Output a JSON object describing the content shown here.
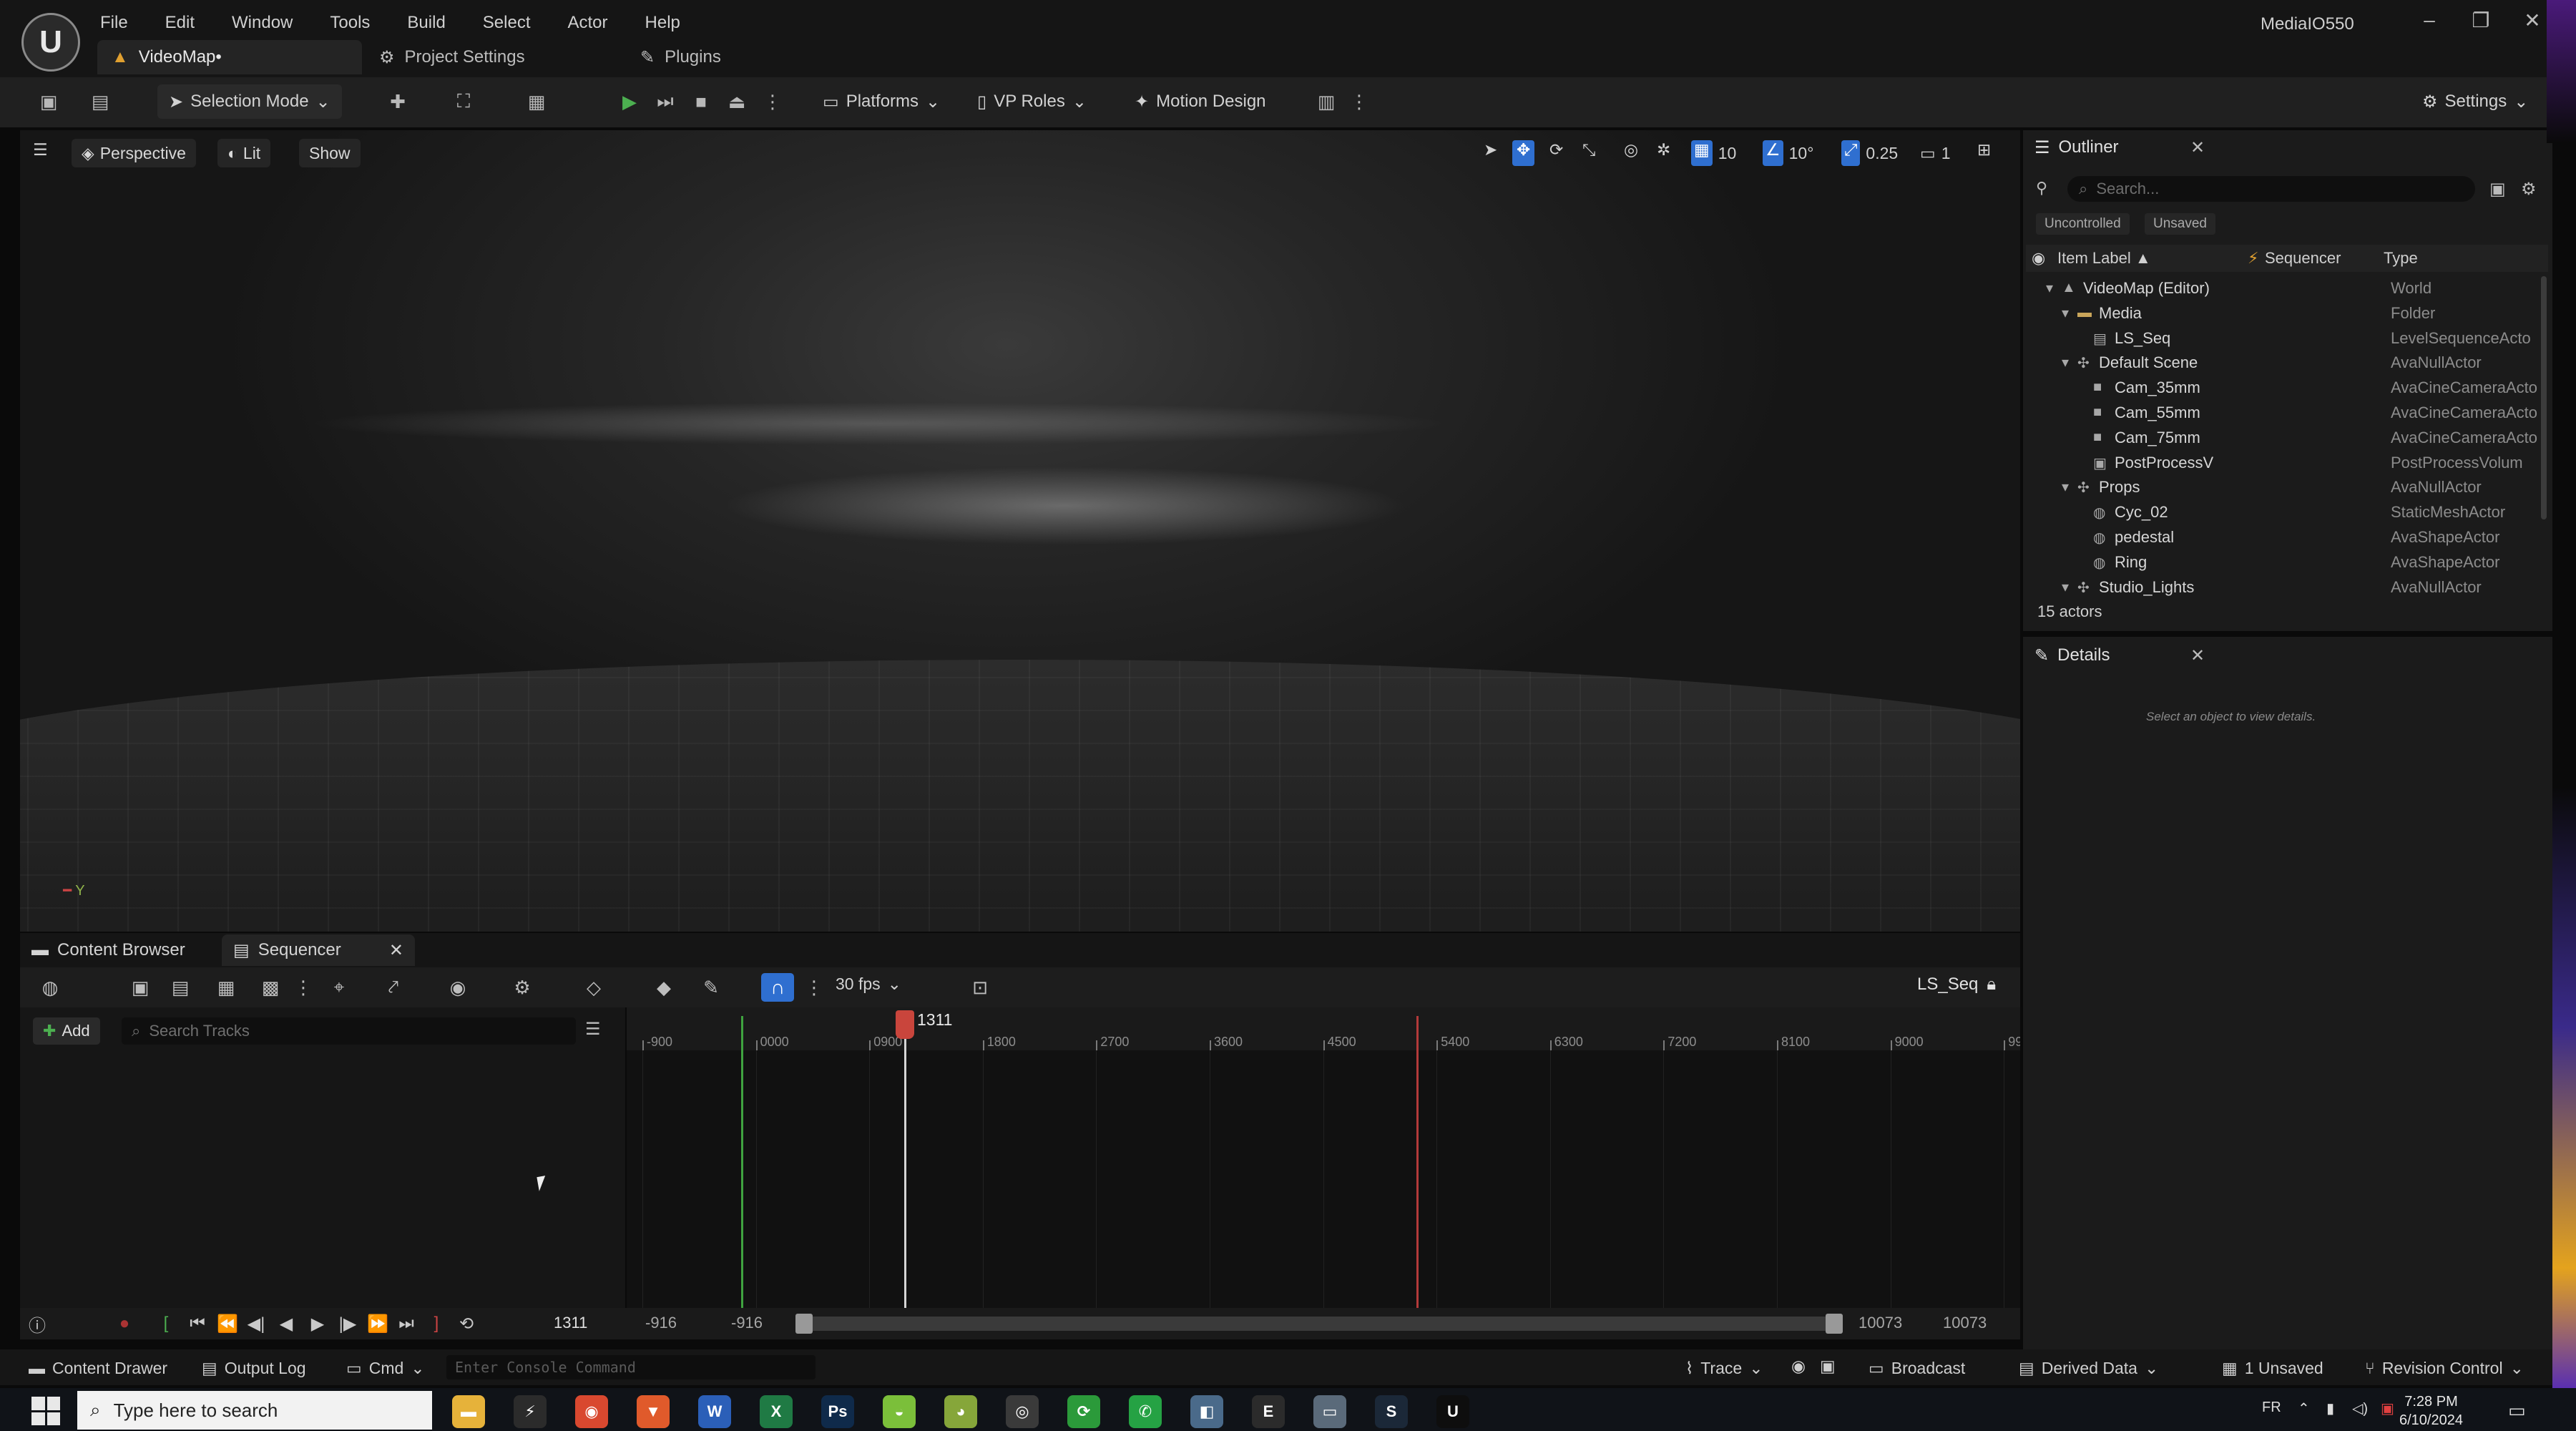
{
  "app": {
    "logo": "U",
    "menu": [
      "File",
      "Edit",
      "Window",
      "Tools",
      "Build",
      "Select",
      "Actor",
      "Help"
    ],
    "tabs": [
      {
        "label": "VideoMap•"
      },
      {
        "label": "Project Settings"
      },
      {
        "label": "Plugins"
      }
    ],
    "user": "MediaIO550",
    "window_controls": {
      "minimize": "–",
      "restore": "❐",
      "close": "✕"
    }
  },
  "toolbar": {
    "selection_mode": "Selection Mode",
    "platforms": "Platforms",
    "vp_roles": "VP Roles",
    "motion_design": "Motion Design",
    "settings": "Settings"
  },
  "viewport": {
    "perspective": "Perspective",
    "lit": "Lit",
    "show": "Show",
    "grid_snap": "10",
    "rotation_snap": "10°",
    "scale_snap": "0.25",
    "camera_speed": "1",
    "axis_label": "Y"
  },
  "outliner": {
    "title": "Outliner",
    "search_placeholder": "Search...",
    "filters": [
      "Uncontrolled",
      "Unsaved"
    ],
    "columns": {
      "label": "Item Label ▲",
      "sequencer": "Sequencer",
      "type": "Type"
    },
    "rows": [
      {
        "label": "VideoMap (Editor)",
        "type": "World",
        "indent": 0,
        "icon": "▲"
      },
      {
        "label": "Media",
        "type": "Folder",
        "indent": 1,
        "icon": "▬"
      },
      {
        "label": "LS_Seq",
        "type": "LevelSequenceActo",
        "indent": 2,
        "icon": "▤"
      },
      {
        "label": "Default Scene",
        "type": "AvaNullActor",
        "indent": 1,
        "icon": "✣"
      },
      {
        "label": "Cam_35mm",
        "type": "AvaCineCameraActo",
        "indent": 2,
        "icon": "■"
      },
      {
        "label": "Cam_55mm",
        "type": "AvaCineCameraActo",
        "indent": 2,
        "icon": "■"
      },
      {
        "label": "Cam_75mm",
        "type": "AvaCineCameraActo",
        "indent": 2,
        "icon": "■"
      },
      {
        "label": "PostProcessV",
        "type": "PostProcessVolum",
        "indent": 2,
        "icon": "▣"
      },
      {
        "label": "Props",
        "type": "AvaNullActor",
        "indent": 1,
        "icon": "✣"
      },
      {
        "label": "Cyc_02",
        "type": "StaticMeshActor",
        "indent": 2,
        "icon": "◍"
      },
      {
        "label": "pedestal",
        "type": "AvaShapeActor",
        "indent": 2,
        "icon": "◍"
      },
      {
        "label": "Ring",
        "type": "AvaShapeActor",
        "indent": 2,
        "icon": "◍"
      },
      {
        "label": "Studio_Lights",
        "type": "AvaNullActor",
        "indent": 1,
        "icon": "✣"
      }
    ],
    "count": "15 actors"
  },
  "details": {
    "title": "Details",
    "empty_text": "Select an object to view details."
  },
  "dock": {
    "content_browser": "Content Browser",
    "sequencer": "Sequencer"
  },
  "sequencer": {
    "fps": "30 fps",
    "sequence_name": "LS_Seq",
    "add_label": "Add",
    "search_placeholder": "Search Tracks",
    "current_frame": "1311",
    "ruler_labels": [
      "-900",
      "0000",
      "0900",
      "1800",
      "2700",
      "3600",
      "4500",
      "5400",
      "6300",
      "7200",
      "8100",
      "9000",
      "99"
    ],
    "range_start_view": "-916",
    "range_start_play": "-916",
    "range_end_play": "10073",
    "range_end_view": "10073"
  },
  "statusbar": {
    "content_drawer": "Content Drawer",
    "output_log": "Output Log",
    "cmd": "Cmd",
    "console_placeholder": "Enter Console Command",
    "trace": "Trace",
    "broadcast": "Broadcast",
    "derived_data": "Derived Data",
    "unsaved": "1 Unsaved",
    "revision_control": "Revision Control"
  },
  "taskbar": {
    "search_placeholder": "Type here to search",
    "language": "FR",
    "time": "7:28 PM",
    "date": "6/10/2024",
    "apps": [
      {
        "name": "file-explorer",
        "glyph": "▬",
        "color": "#e6b23a"
      },
      {
        "name": "app-2",
        "glyph": "⚡",
        "color": "#2b2b2b"
      },
      {
        "name": "chrome",
        "glyph": "◉",
        "color": "#d9482f"
      },
      {
        "name": "brave",
        "glyph": "▼",
        "color": "#e05a2b"
      },
      {
        "name": "word",
        "glyph": "W",
        "color": "#2b5fb8"
      },
      {
        "name": "excel",
        "glyph": "X",
        "color": "#1f7a44"
      },
      {
        "name": "photoshop",
        "glyph": "Ps",
        "color": "#0f2a4a"
      },
      {
        "name": "android",
        "glyph": "◒",
        "color": "#7bbf3a"
      },
      {
        "name": "app-9",
        "glyph": "◕",
        "color": "#86a63a"
      },
      {
        "name": "obs",
        "glyph": "◎",
        "color": "#3a3a3a"
      },
      {
        "name": "sync",
        "glyph": "⟳",
        "color": "#2b9a3a"
      },
      {
        "name": "whatsapp",
        "glyph": "✆",
        "color": "#25a244"
      },
      {
        "name": "app-13",
        "glyph": "◧",
        "color": "#4a6a8a"
      },
      {
        "name": "epic",
        "glyph": "E",
        "color": "#2b2b2b"
      },
      {
        "name": "app-15",
        "glyph": "▭",
        "color": "#5a6a7a"
      },
      {
        "name": "steam",
        "glyph": "S",
        "color": "#1b2838"
      },
      {
        "name": "unreal",
        "glyph": "U",
        "color": "#0e0e0e"
      }
    ]
  },
  "colors": {
    "accent_blue": "#2f6fd0",
    "play_green": "#3fa33f",
    "playhead_red": "#c9453c"
  }
}
